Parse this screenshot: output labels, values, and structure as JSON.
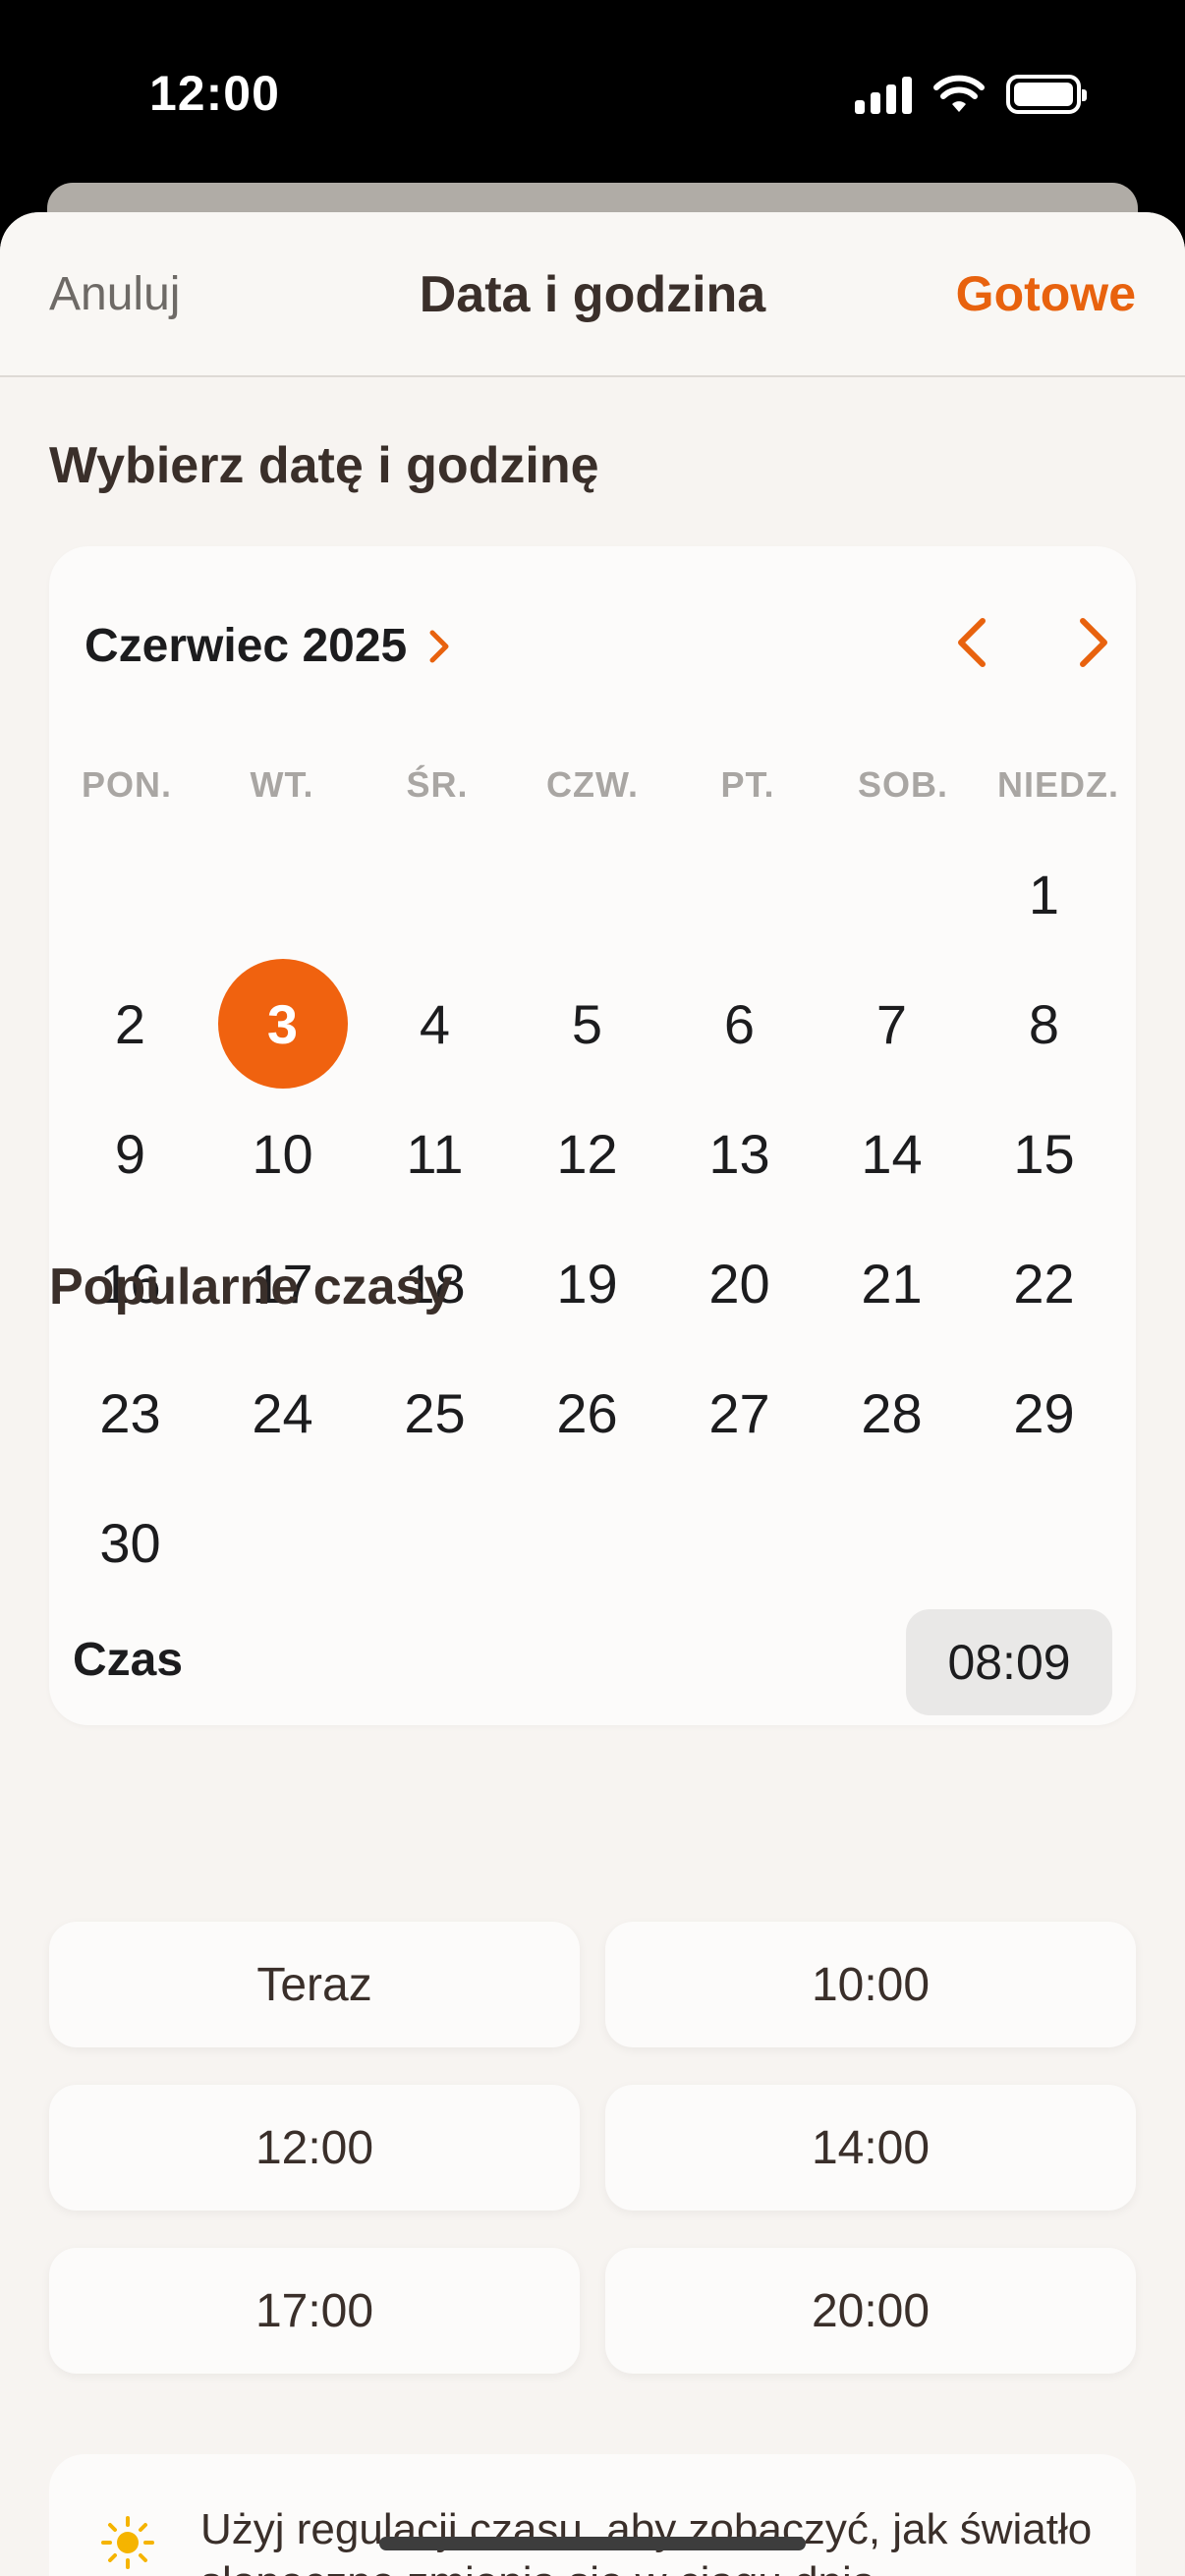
{
  "status_bar": {
    "time": "12:00"
  },
  "nav": {
    "cancel": "Anuluj",
    "title": "Data i godzina",
    "done": "Gotowe"
  },
  "heading": "Wybierz datę i godzinę",
  "calendar": {
    "month": "Czerwiec 2025",
    "weekdays": [
      "PON.",
      "WT.",
      "ŚR.",
      "CZW.",
      "PT.",
      "SOB.",
      "NIEDZ."
    ],
    "days": [
      "1",
      "2",
      "3",
      "4",
      "5",
      "6",
      "7",
      "8",
      "9",
      "10",
      "11",
      "12",
      "13",
      "14",
      "15",
      "16",
      "17",
      "18",
      "19",
      "20",
      "21",
      "22",
      "23",
      "24",
      "25",
      "26",
      "27",
      "28",
      "29",
      "30"
    ],
    "selected_day": "3",
    "time_label": "Czas",
    "time_value": "08:09"
  },
  "popular": {
    "heading": "Popularne czasy",
    "items": [
      "Teraz",
      "10:00",
      "12:00",
      "14:00",
      "17:00",
      "20:00"
    ]
  },
  "info": {
    "text": "Użyj regulacji czasu, aby zobaczyć, jak światło słoneczne zmienia się w ciągu dnia"
  },
  "colors": {
    "accent": "#f0620f",
    "background": "#f7f4f1"
  }
}
